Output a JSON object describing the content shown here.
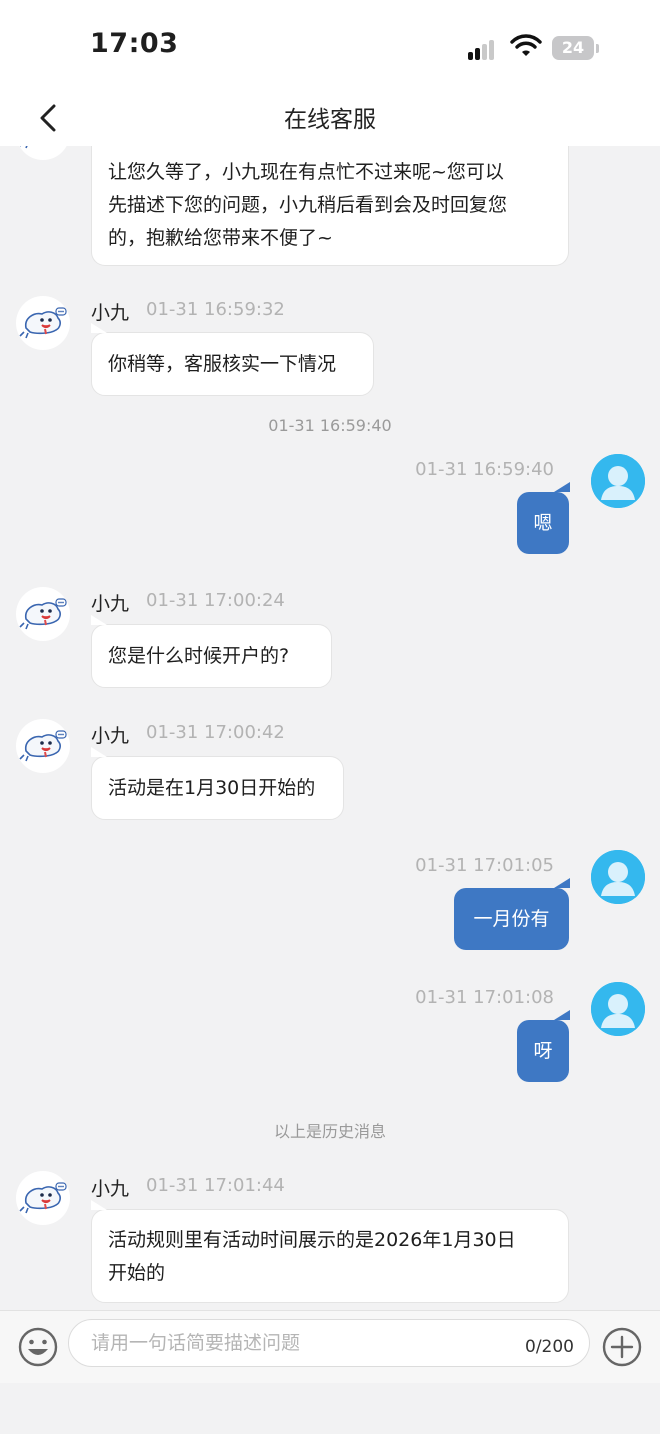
{
  "status_bar": {
    "time": "17:03",
    "battery": "24"
  },
  "header": {
    "title": "在线客服"
  },
  "messages": [
    {
      "side": "in",
      "lines": [
        "让您久等了，小九现在有点忙不过来呢~您可以",
        "先描述下您的问题，小九稍后看到会及时回复您",
        "的，抱歉给您带来不便了~"
      ]
    },
    {
      "side": "in",
      "sender": "小九",
      "time": "01-31 16:59:32",
      "text": "你稍等，客服核实一下情况"
    },
    {
      "side": "system",
      "text": "01-31 16:59:40"
    },
    {
      "side": "out",
      "time": "01-31 16:59:40",
      "text": "嗯"
    },
    {
      "side": "in",
      "sender": "小九",
      "time": "01-31 17:00:24",
      "text": "您是什么时候开户的?"
    },
    {
      "side": "in",
      "sender": "小九",
      "time": "01-31 17:00:42",
      "text": "活动是在1月30日开始的"
    },
    {
      "side": "out",
      "time": "01-31 17:01:05",
      "text": "一月份有"
    },
    {
      "side": "out",
      "time": "01-31 17:01:08",
      "text": "呀"
    },
    {
      "side": "system",
      "text": "以上是历史消息"
    },
    {
      "side": "in",
      "sender": "小九",
      "time": "01-31 17:01:44",
      "lines": [
        "活动规则里有活动时间展示的是2026年1月30日",
        "开始的"
      ]
    }
  ],
  "input": {
    "placeholder": "请用一句话简要描述问题",
    "counter": "0/200"
  },
  "colors": {
    "user_bubble": "#3e78c4",
    "user_avatar": "#34b8ee",
    "chat_background": "#f2f2f3"
  },
  "icons": [
    "back-arrow-icon",
    "signal-icon",
    "wifi-icon",
    "battery-icon",
    "seal-mascot-icon",
    "user-silhouette-icon",
    "emoji-icon",
    "plus-icon"
  ]
}
